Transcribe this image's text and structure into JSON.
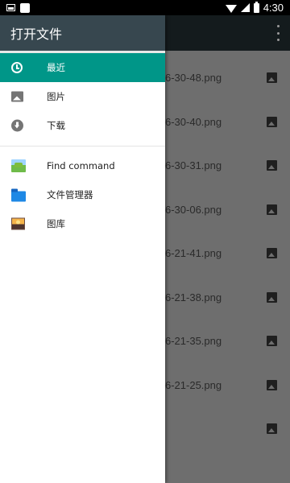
{
  "status_bar": {
    "time": "4:30",
    "icons": [
      "image-notification-icon",
      "square-notification-icon",
      "wifi-icon",
      "signal-icon",
      "battery-icon"
    ]
  },
  "drawer": {
    "title": "打开文件",
    "items": [
      {
        "label": "最近",
        "icon": "clock-icon",
        "selected": true
      },
      {
        "label": "图片",
        "icon": "image-icon",
        "selected": false
      },
      {
        "label": "下载",
        "icon": "download-icon",
        "selected": false
      }
    ],
    "apps": [
      {
        "label": "Find command",
        "icon": "find-command-app-icon"
      },
      {
        "label": "文件管理器",
        "icon": "folder-icon"
      },
      {
        "label": "图库",
        "icon": "gallery-icon"
      }
    ]
  },
  "files": [
    {
      "name": "6-30-48.png"
    },
    {
      "name": "6-30-40.png"
    },
    {
      "name": "6-30-31.png"
    },
    {
      "name": "6-30-06.png"
    },
    {
      "name": "6-21-41.png"
    },
    {
      "name": "6-21-38.png"
    },
    {
      "name": "6-21-35.png"
    },
    {
      "name": "6-21-25.png"
    },
    {
      "name": ""
    }
  ],
  "colors": {
    "accent": "#009688",
    "drawer_header": "#37474f",
    "scrim": "#6e6e6e"
  }
}
